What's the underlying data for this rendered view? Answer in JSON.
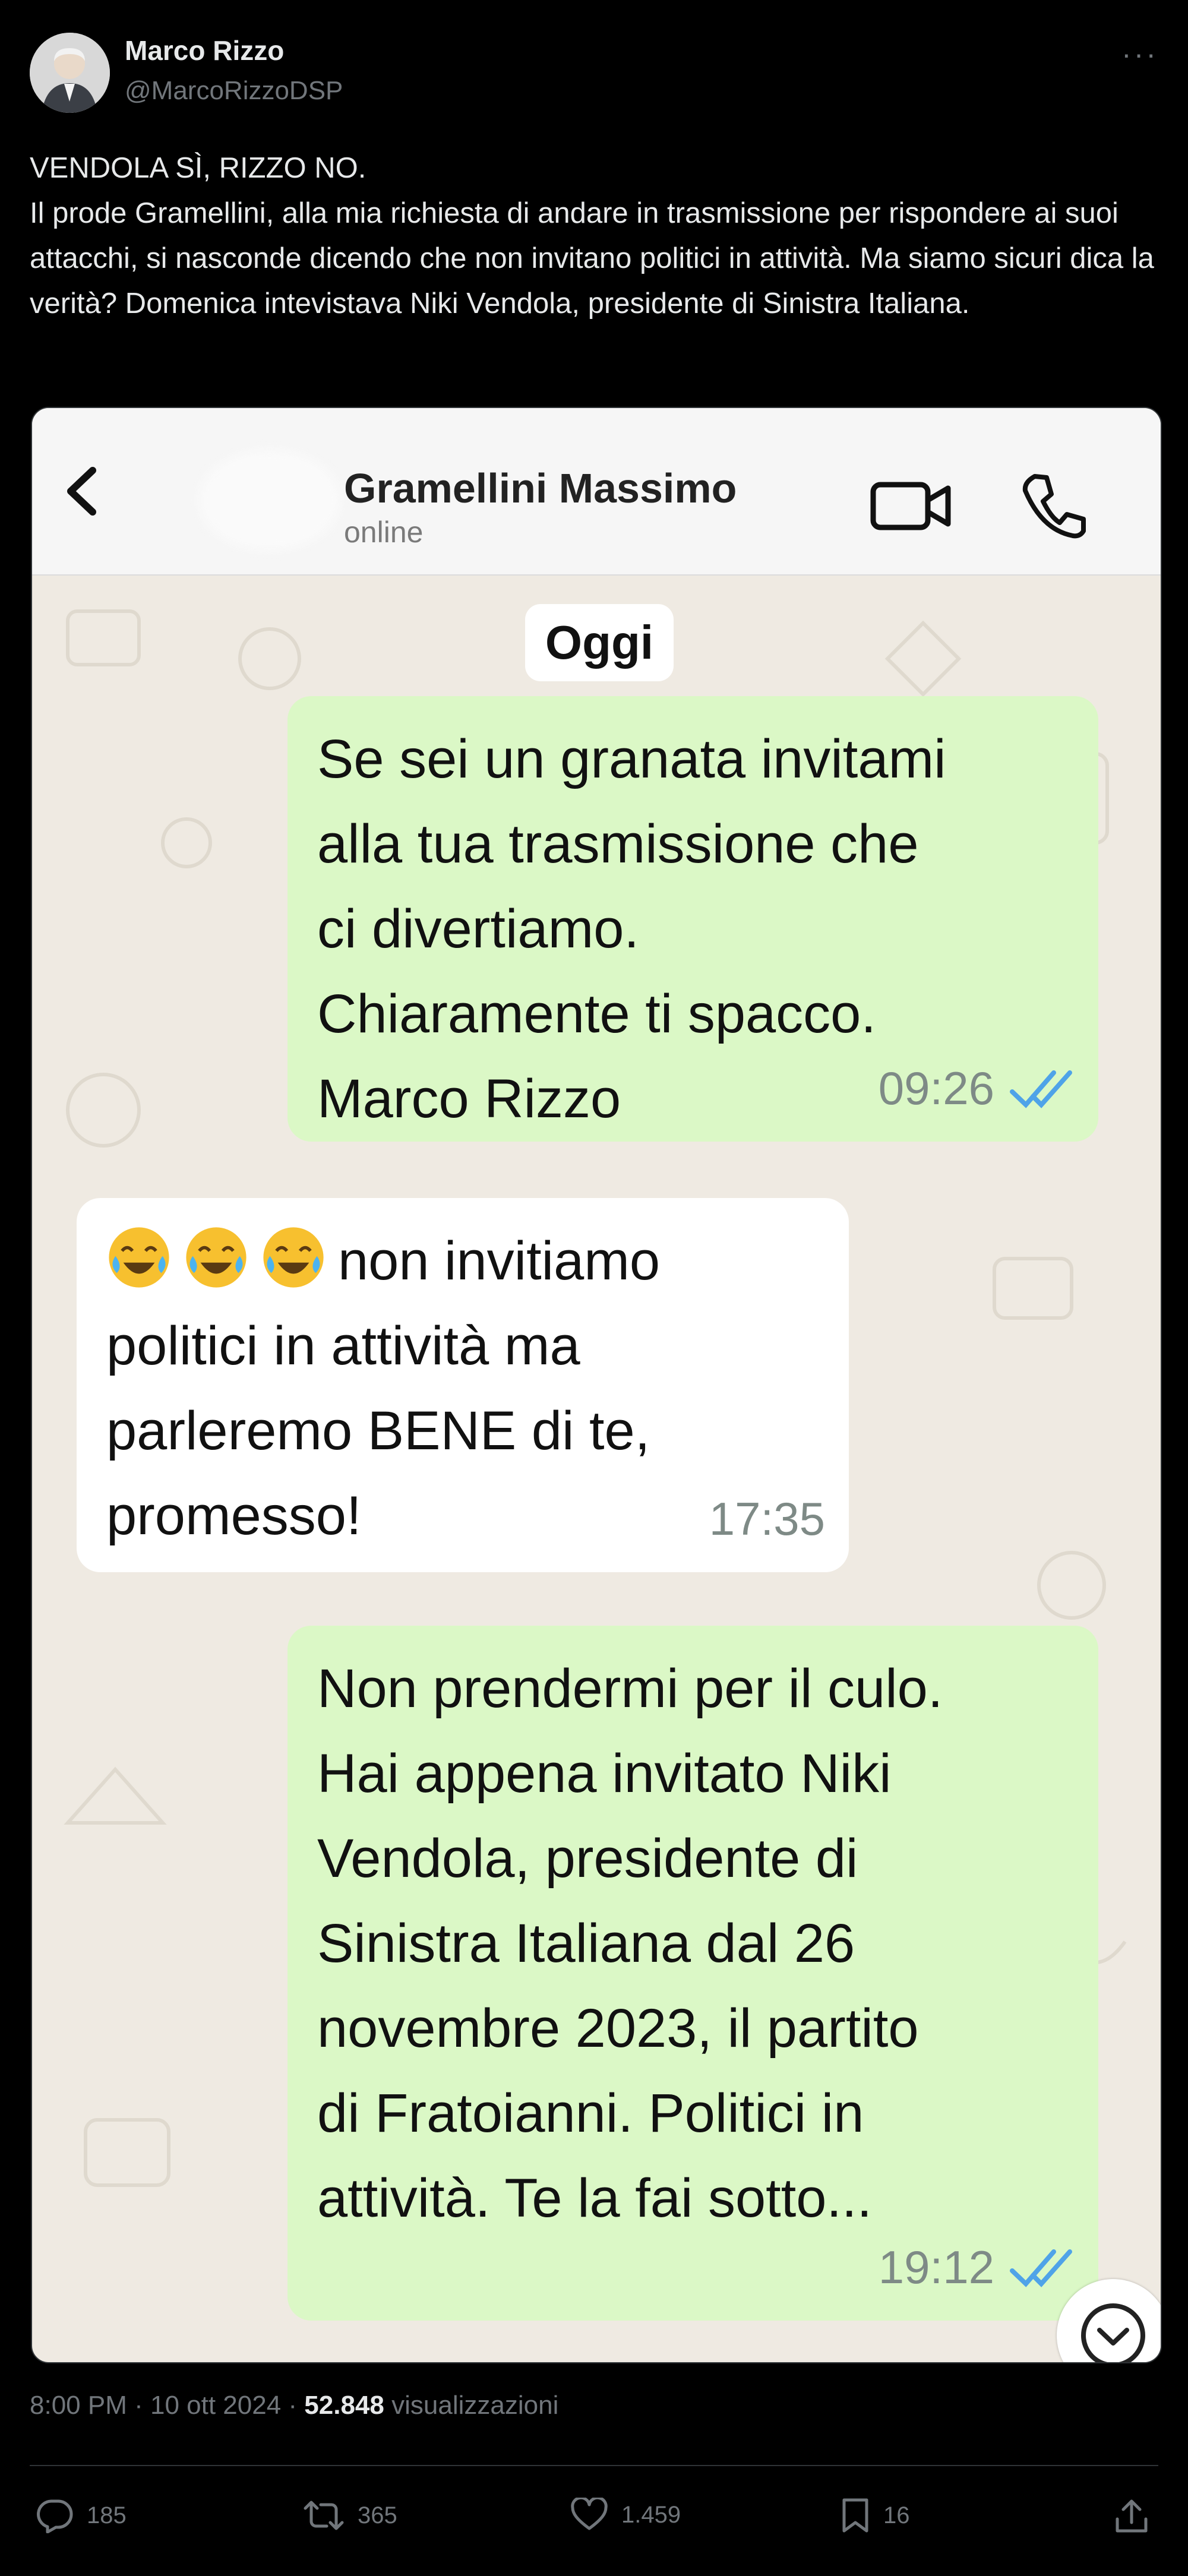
{
  "tweet": {
    "author_name": "Marco Rizzo",
    "author_handle": "@MarcoRizzoDSP",
    "more_icon": "more-horizontal-icon",
    "headline": "VENDOLA SÌ, RIZZO NO.",
    "body": "Il prode Gramellini, alla mia richiesta di andare in trasmissione per rispondere ai suoi attacchi, si nasconde dicendo che non invitano politici in attività. Ma siamo sicuri dica la verità? Domenica intevistava Niki Vendola, presidente di Sinistra Italiana.",
    "time": "8:00 PM",
    "date": "10 ott 2024",
    "views_count": "52.848",
    "views_label": "visualizzazioni"
  },
  "chat": {
    "contact_name": "Gramellini Massimo",
    "contact_status": "online",
    "date_label": "Oggi",
    "messages": [
      {
        "direction": "out",
        "text": "Se sei un granata invitami\nalla tua trasmissione che\nci divertiamo.\nChiaramente ti spacco.\nMarco Rizzo",
        "time": "09:26",
        "read": true
      },
      {
        "direction": "in",
        "emoji": "😂😂😂",
        "text": "non invitiamo\npolitici in attività ma\nparleremo BENE di te,\npromesso!",
        "time": "17:35"
      },
      {
        "direction": "out",
        "text": "Non prendermi per il culo.\nHai appena invitato Niki\nVendola, presidente di\nSinistra Italiana dal 26\nnovembre 2023, il partito\ndi Fratoianni. Politici in\nattività. Te la fai sotto...",
        "time": "19:12",
        "read": true
      }
    ]
  },
  "actions": {
    "replies": "185",
    "reposts": "365",
    "likes": "1.459",
    "bookmarks": "16"
  },
  "colors": {
    "background": "#000000",
    "text_primary": "#e7e9ea",
    "text_secondary": "#71767b",
    "bubble_out": "#dbf8c6",
    "bubble_in": "#ffffff",
    "chat_bg": "#efeae2",
    "read_ticks": "#4fa3e8"
  }
}
